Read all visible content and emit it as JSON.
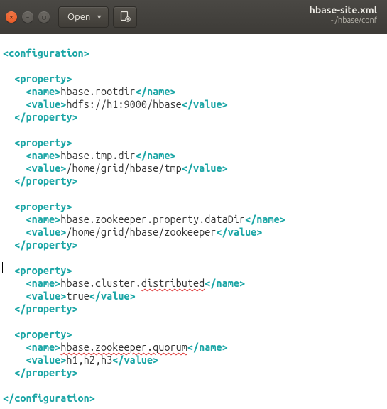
{
  "titlebar": {
    "open_label": "Open",
    "file_title": "hbase-site.xml",
    "file_path": "~/hbase/conf"
  },
  "xml": {
    "root_open": "<configuration>",
    "root_close": "</configuration>",
    "prop_open": "<property>",
    "prop_close": "</property>",
    "name_open": "<name>",
    "name_close": "</name>",
    "value_open": "<value>",
    "value_close": "</value>",
    "properties": [
      {
        "name": "hbase.rootdir",
        "value": "hdfs://h1:9000/hbase",
        "name_spell": false
      },
      {
        "name": "hbase.tmp.dir",
        "value": "/home/grid/hbase/tmp",
        "name_spell": false
      },
      {
        "name": "hbase.zookeeper.property.dataDir",
        "value": "/home/grid/hbase/zookeeper",
        "name_spell": false
      },
      {
        "name_prefix": "hbase.cluster.",
        "name_spelled": "distributed",
        "value": "true",
        "name_spell": true
      },
      {
        "name_spelled": "hbase.zookeeper.quorum",
        "value": "h1,h2,h3",
        "name_spell": true
      }
    ]
  }
}
